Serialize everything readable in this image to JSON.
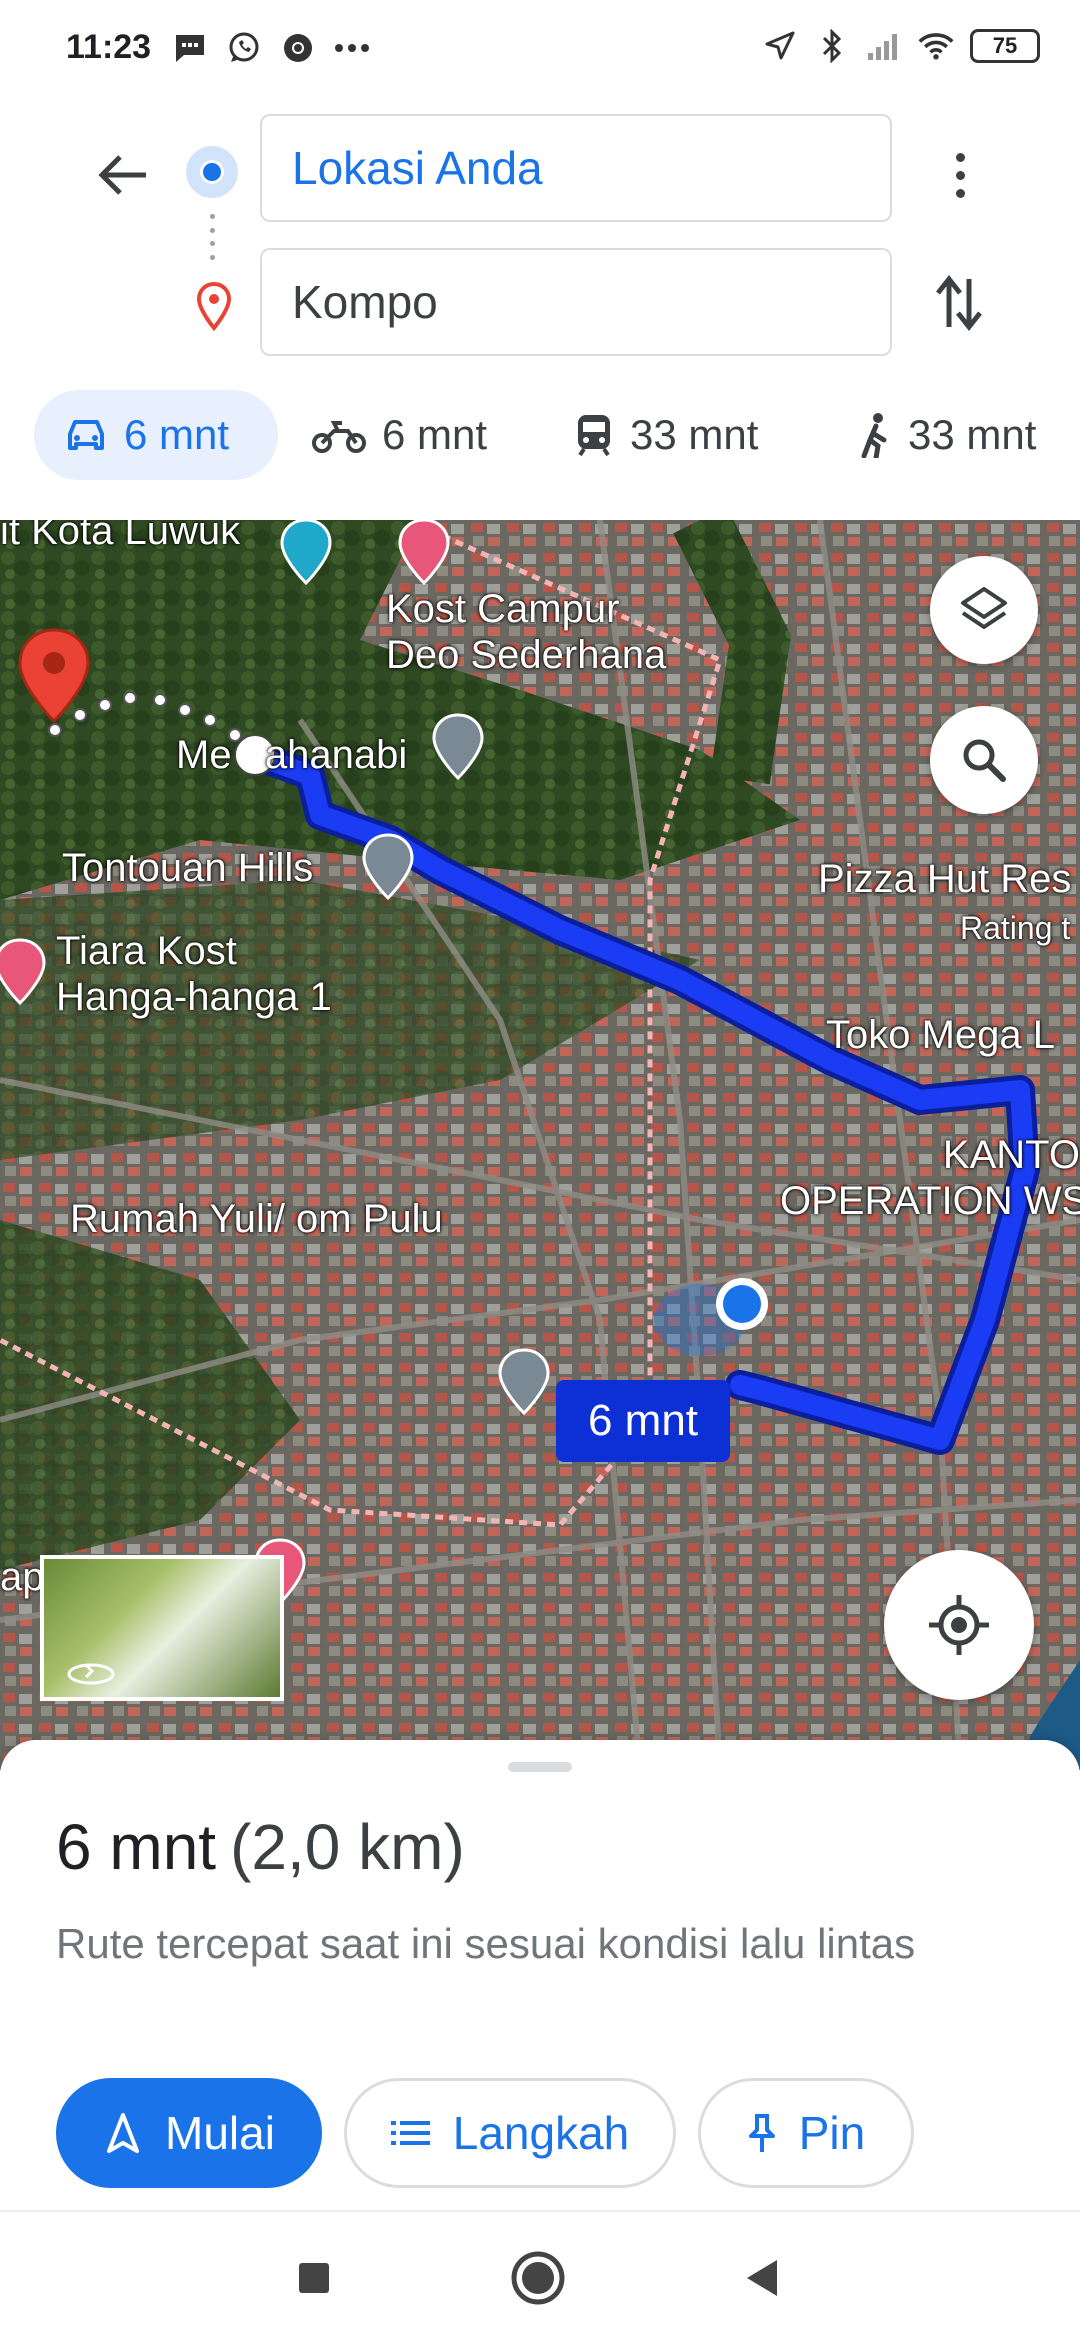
{
  "status_bar": {
    "time": "11:23",
    "left_icons": [
      "message-icon",
      "whatsapp-icon",
      "chrome-icon",
      "more-dots-icon"
    ],
    "right_icons": [
      "location-arrow-icon",
      "bluetooth-icon",
      "signal-icon",
      "wifi-icon"
    ],
    "battery": "75"
  },
  "directions": {
    "origin_value": "Lokasi Anda",
    "destination_value": "Kompo"
  },
  "modes": [
    {
      "icon": "car-icon",
      "label": "6 mnt",
      "active": true
    },
    {
      "icon": "motorcycle-icon",
      "label": "6 mnt",
      "active": false
    },
    {
      "icon": "transit-icon",
      "label": "33 mnt",
      "active": false
    },
    {
      "icon": "walk-icon",
      "label": "33 mnt",
      "active": false
    }
  ],
  "map": {
    "labels": {
      "kota_luwuk": "it Kota Luwuk",
      "kost_campur": "Kost Campur\nDeo Sederhana",
      "mesjid": "Me   ahanabi",
      "tontouan": "Tontouan Hills",
      "pizza_hut": "Pizza Hut Res",
      "rating": "Rating t",
      "tiara_kost": "Tiara Kost\nHanga-hanga 1",
      "toko_mega": "Toko Mega L",
      "kantor": "KANTO\nOPERATION WS",
      "rumah_yuli": "Rumah Yuli/ om Pulu",
      "ap": "ap"
    },
    "route_duration_badge": "6 mnt",
    "colors": {
      "route": "#1a3cf5",
      "accent": "#1a73e8",
      "destination_pin": "#ea4335"
    }
  },
  "trip": {
    "duration": "6 mnt",
    "distance": "(2,0 km)",
    "note": "Rute tercepat saat ini sesuai kondisi lalu lintas"
  },
  "actions": {
    "start": "Mulai",
    "steps": "Langkah",
    "pin": "Pin"
  }
}
